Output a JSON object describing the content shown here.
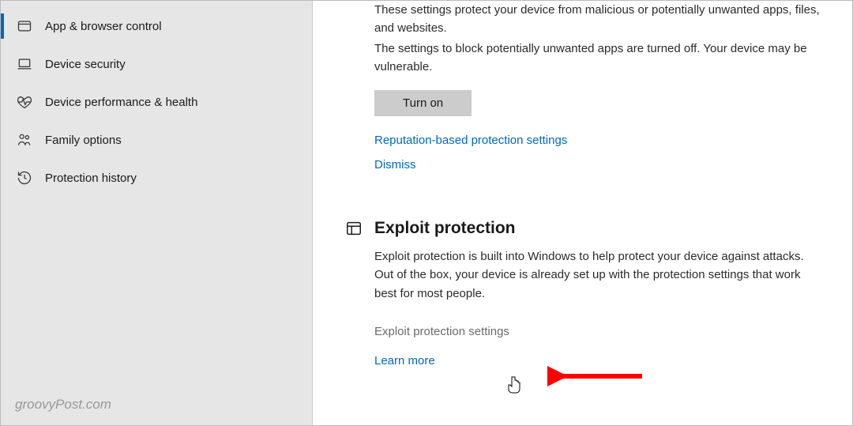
{
  "sidebar": {
    "items": [
      {
        "label": "App & browser control",
        "active": true
      },
      {
        "label": "Device security",
        "active": false
      },
      {
        "label": "Device performance & health",
        "active": false
      },
      {
        "label": "Family options",
        "active": false
      },
      {
        "label": "Protection history",
        "active": false
      }
    ]
  },
  "main": {
    "reputation": {
      "desc1": "These settings protect your device from malicious or potentially unwanted apps, files, and websites.",
      "desc2": "The settings to block potentially unwanted apps are turned off. Your device may be vulnerable.",
      "turn_on_label": "Turn on",
      "settings_link": "Reputation-based protection settings",
      "dismiss_link": "Dismiss"
    },
    "exploit": {
      "heading": "Exploit protection",
      "desc": "Exploit protection is built into Windows to help protect your device against attacks.  Out of the box, your device is already set up with the protection settings that work best for most people.",
      "settings_link": "Exploit protection settings",
      "learn_link": "Learn more"
    }
  },
  "watermark": "groovyPost.com"
}
